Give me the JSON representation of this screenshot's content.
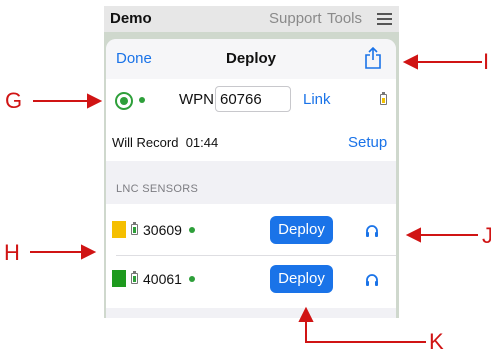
{
  "app": {
    "title": "Demo",
    "support_label": "Support",
    "tools_label": "Tools",
    "menu_icon": "hamburger-icon"
  },
  "panel": {
    "done_label": "Done",
    "title": "Deploy",
    "share_icon": "share-icon"
  },
  "wpn": {
    "label": "WPN",
    "value": "60766",
    "link_label": "Link",
    "status_icon": "radio-target-icon",
    "battery_color": "#f2c200"
  },
  "record": {
    "label": "Will Record",
    "time": "01:44",
    "setup_label": "Setup"
  },
  "sensors_section": {
    "header": "LNC SENSORS",
    "items": [
      {
        "id": "30609",
        "color": "#f5bf00",
        "deploy_label": "Deploy",
        "battery_color": "#2e9f3a"
      },
      {
        "id": "40061",
        "color": "#1e9a1e",
        "deploy_label": "Deploy",
        "battery_color": "#2e9f3a"
      }
    ]
  },
  "annotations": {
    "G": "G",
    "H": "H",
    "I": "I",
    "J": "J",
    "K": "K",
    "color": "#d01414"
  }
}
